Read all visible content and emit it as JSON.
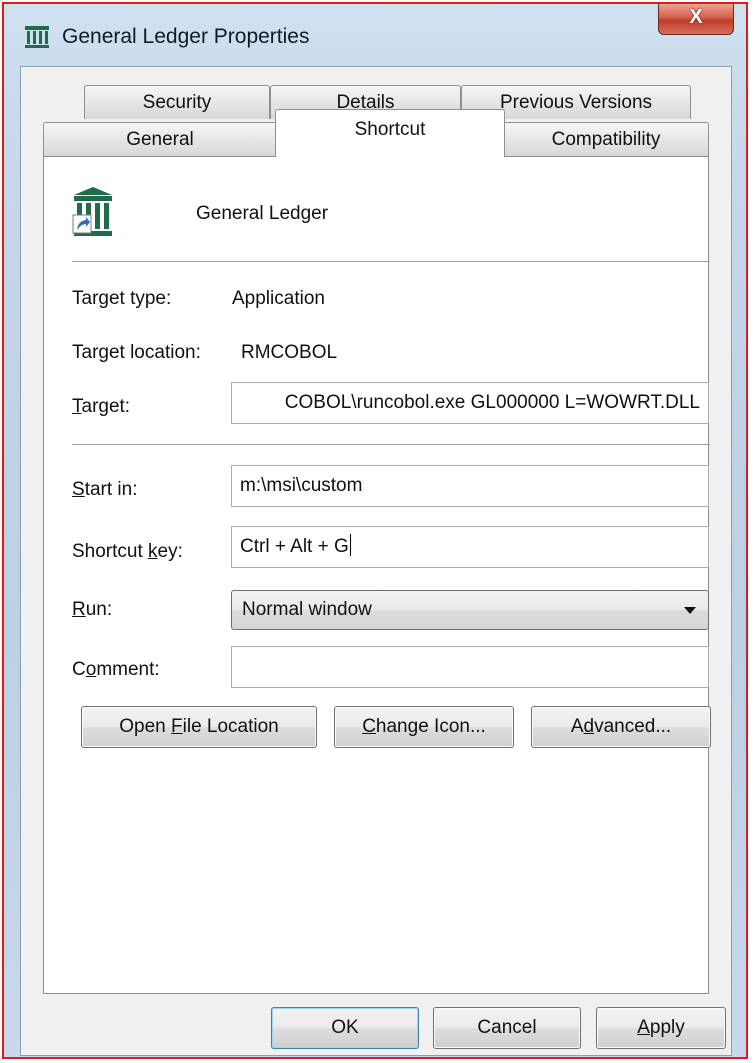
{
  "window": {
    "title": "General Ledger Properties",
    "close_symbol": "X",
    "app_icon": "general-ledger-building-icon"
  },
  "tabs": {
    "row_back": [
      {
        "label": "Security"
      },
      {
        "label": "Details"
      },
      {
        "label": "Previous Versions"
      }
    ],
    "row_front": [
      {
        "label": "General"
      },
      {
        "label": "Shortcut",
        "active": true
      },
      {
        "label": "Compatibility"
      }
    ]
  },
  "shortcut": {
    "name": "General Ledger",
    "target_type_label": "Target type:",
    "target_type_value": "Application",
    "target_location_label": "Target location:",
    "target_location_value": "RMCOBOL",
    "target_label": {
      "pre": "",
      "key": "T",
      "post": "arget:"
    },
    "target_value": "COBOL\\runcobol.exe GL000000 L=WOWRT.DLL",
    "start_in_label": {
      "pre": "",
      "key": "S",
      "post": "tart in:"
    },
    "start_in_value": "m:\\msi\\custom",
    "shortcut_key_label": {
      "pre": "Shortcut ",
      "key": "k",
      "post": "ey:"
    },
    "shortcut_key_value": "Ctrl + Alt + G",
    "run_label": {
      "pre": "",
      "key": "R",
      "post": "un:"
    },
    "run_value": "Normal window",
    "comment_label": {
      "pre": "C",
      "key": "o",
      "post": "mment:"
    },
    "comment_value": "",
    "buttons": {
      "open_file_location": {
        "pre": "Open ",
        "key": "F",
        "post": "ile Location"
      },
      "change_icon": {
        "pre": "",
        "key": "C",
        "post": "hange Icon..."
      },
      "advanced": {
        "pre": "A",
        "key": "d",
        "post": "vanced..."
      }
    }
  },
  "footer": {
    "ok": "OK",
    "cancel": "Cancel",
    "apply": {
      "pre": "",
      "key": "A",
      "post": "pply"
    }
  },
  "colors": {
    "window_border": "#e01b1b",
    "close_button": "#c03d28",
    "icon_green": "#1f6b4a",
    "shortcut_arrow_blue": "#2b6cc4"
  }
}
